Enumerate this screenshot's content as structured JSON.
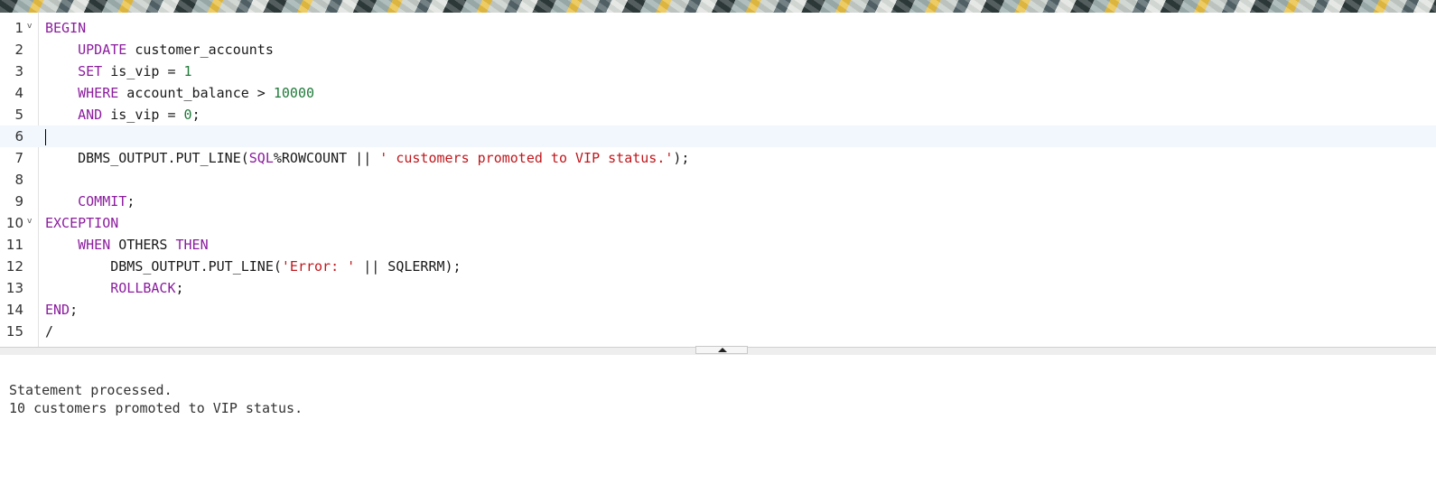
{
  "editor": {
    "lines": [
      {
        "num": "1",
        "fold": "v",
        "tokens": [
          {
            "t": "BEGIN",
            "c": "kw"
          }
        ]
      },
      {
        "num": "2",
        "tokens": [
          {
            "t": "    "
          },
          {
            "t": "UPDATE",
            "c": "kw"
          },
          {
            "t": " customer_accounts"
          }
        ]
      },
      {
        "num": "3",
        "tokens": [
          {
            "t": "    "
          },
          {
            "t": "SET",
            "c": "kw"
          },
          {
            "t": " is_vip = "
          },
          {
            "t": "1",
            "c": "num"
          }
        ]
      },
      {
        "num": "4",
        "tokens": [
          {
            "t": "    "
          },
          {
            "t": "WHERE",
            "c": "kw"
          },
          {
            "t": " account_balance > "
          },
          {
            "t": "10000",
            "c": "num"
          }
        ]
      },
      {
        "num": "5",
        "tokens": [
          {
            "t": "    "
          },
          {
            "t": "AND",
            "c": "kw"
          },
          {
            "t": " is_vip = "
          },
          {
            "t": "0",
            "c": "num"
          },
          {
            "t": ";"
          }
        ]
      },
      {
        "num": "6",
        "active": true,
        "caret": true,
        "tokens": []
      },
      {
        "num": "7",
        "tokens": [
          {
            "t": "    DBMS_OUTPUT.PUT_LINE("
          },
          {
            "t": "SQL",
            "c": "kw"
          },
          {
            "t": "%ROWCOUNT || "
          },
          {
            "t": "' customers promoted to VIP status.'",
            "c": "str"
          },
          {
            "t": ");"
          }
        ]
      },
      {
        "num": "8",
        "tokens": []
      },
      {
        "num": "9",
        "tokens": [
          {
            "t": "    "
          },
          {
            "t": "COMMIT",
            "c": "kw"
          },
          {
            "t": ";"
          }
        ]
      },
      {
        "num": "10",
        "fold": "v",
        "tokens": [
          {
            "t": "EXCEPTION",
            "c": "kw"
          }
        ]
      },
      {
        "num": "11",
        "tokens": [
          {
            "t": "    "
          },
          {
            "t": "WHEN",
            "c": "kw"
          },
          {
            "t": " OTHERS "
          },
          {
            "t": "THEN",
            "c": "kw"
          }
        ]
      },
      {
        "num": "12",
        "tokens": [
          {
            "t": "        DBMS_OUTPUT.PUT_LINE("
          },
          {
            "t": "'Error: '",
            "c": "str"
          },
          {
            "t": " || SQLERRM);"
          }
        ]
      },
      {
        "num": "13",
        "tokens": [
          {
            "t": "        "
          },
          {
            "t": "ROLLBACK",
            "c": "kw"
          },
          {
            "t": ";"
          }
        ]
      },
      {
        "num": "14",
        "tokens": [
          {
            "t": "END",
            "c": "kw"
          },
          {
            "t": ";"
          }
        ]
      },
      {
        "num": "15",
        "tokens": [
          {
            "t": "/"
          }
        ]
      }
    ]
  },
  "output": {
    "lines": [
      "Statement processed.",
      "10 customers promoted to VIP status."
    ]
  },
  "colors": {
    "keyword": "#8b1d9e",
    "number": "#1f7a3a",
    "string": "#c0171c",
    "active_line": "#f1f7fd"
  },
  "icons": {
    "fold": "chevron-down-icon",
    "resize": "chevron-up-icon"
  }
}
